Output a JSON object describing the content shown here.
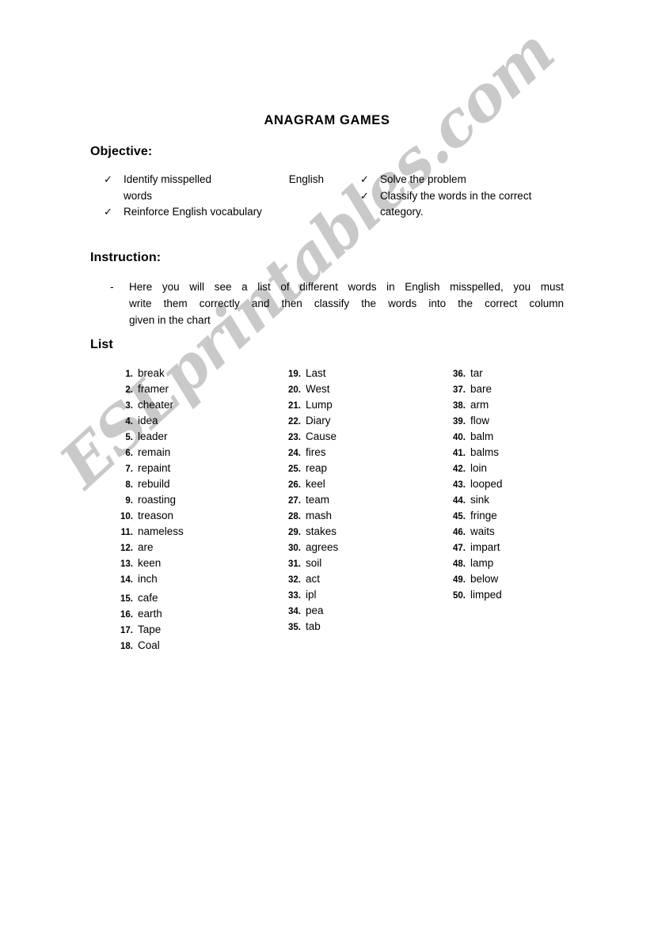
{
  "document": {
    "title": "ANAGRAM GAMES",
    "watermark": "ESLprintables.com",
    "watermark_color": "#c9c9c9"
  },
  "objective": {
    "heading": "Objective:",
    "check_icon": "✓",
    "left_items": [
      {
        "text_start": "Identify misspelled",
        "text_end": "English",
        "text_wrap": "words"
      },
      {
        "text_start": "Reinforce English vocabulary"
      }
    ],
    "right_items": [
      {
        "text_start": "Solve the problem"
      },
      {
        "text_start": "Classify the words in the correct",
        "text_wrap": "category."
      }
    ]
  },
  "instruction": {
    "heading": "Instruction:",
    "dash": "-",
    "line1": "Here you will see a list of different words in English misspelled, you must",
    "line2": "write them correctly and then classify the words into the correct column",
    "line3": "given in the chart"
  },
  "list": {
    "heading": "List",
    "column1": [
      {
        "num": "1.",
        "word": "break"
      },
      {
        "num": "2.",
        "word": "framer"
      },
      {
        "num": "3.",
        "word": "cheater"
      },
      {
        "num": "4.",
        "word": "idea"
      },
      {
        "num": "5.",
        "word": "leader"
      },
      {
        "num": "6.",
        "word": "remain"
      },
      {
        "num": "7.",
        "word": "repaint"
      },
      {
        "num": "8.",
        "word": "rebuild"
      },
      {
        "num": "9.",
        "word": "roasting"
      },
      {
        "num": "10.",
        "word": "treason"
      },
      {
        "num": "11.",
        "word": "nameless"
      },
      {
        "num": "12.",
        "word": "are"
      },
      {
        "num": "13.",
        "word": "keen"
      },
      {
        "num": "14.",
        "word": "inch"
      },
      {
        "num": "15.",
        "word": "cafe"
      },
      {
        "num": "16.",
        "word": "earth"
      },
      {
        "num": "17.",
        "word": "Tape"
      },
      {
        "num": "18.",
        "word": "Coal"
      }
    ],
    "column2": [
      {
        "num": "19.",
        "word": "Last"
      },
      {
        "num": "20.",
        "word": "West"
      },
      {
        "num": "21.",
        "word": "Lump"
      },
      {
        "num": "22.",
        "word": "Diary"
      },
      {
        "num": "23.",
        "word": "Cause"
      },
      {
        "num": "24.",
        "word": "fires"
      },
      {
        "num": "25.",
        "word": "reap"
      },
      {
        "num": "26.",
        "word": "keel"
      },
      {
        "num": "27.",
        "word": "team"
      },
      {
        "num": "28.",
        "word": "mash"
      },
      {
        "num": "29.",
        "word": "stakes"
      },
      {
        "num": "30.",
        "word": "agrees"
      },
      {
        "num": "31.",
        "word": "soil"
      },
      {
        "num": "32.",
        "word": "act"
      },
      {
        "num": "33.",
        "word": "ipl"
      },
      {
        "num": "34.",
        "word": "pea"
      },
      {
        "num": "35.",
        "word": "tab"
      }
    ],
    "column3": [
      {
        "num": "36.",
        "word": "tar"
      },
      {
        "num": "37.",
        "word": "bare"
      },
      {
        "num": "38.",
        "word": "arm"
      },
      {
        "num": "39.",
        "word": "flow"
      },
      {
        "num": "40.",
        "word": "balm"
      },
      {
        "num": "41.",
        "word": "balms"
      },
      {
        "num": "42.",
        "word": "loin"
      },
      {
        "num": "43.",
        "word": "looped"
      },
      {
        "num": "44.",
        "word": "sink"
      },
      {
        "num": "45.",
        "word": "fringe"
      },
      {
        "num": "46.",
        "word": "waits"
      },
      {
        "num": "47.",
        "word": "impart"
      },
      {
        "num": "48.",
        "word": "lamp"
      },
      {
        "num": "49.",
        "word": "below"
      },
      {
        "num": "50.",
        "word": "limped"
      }
    ]
  }
}
